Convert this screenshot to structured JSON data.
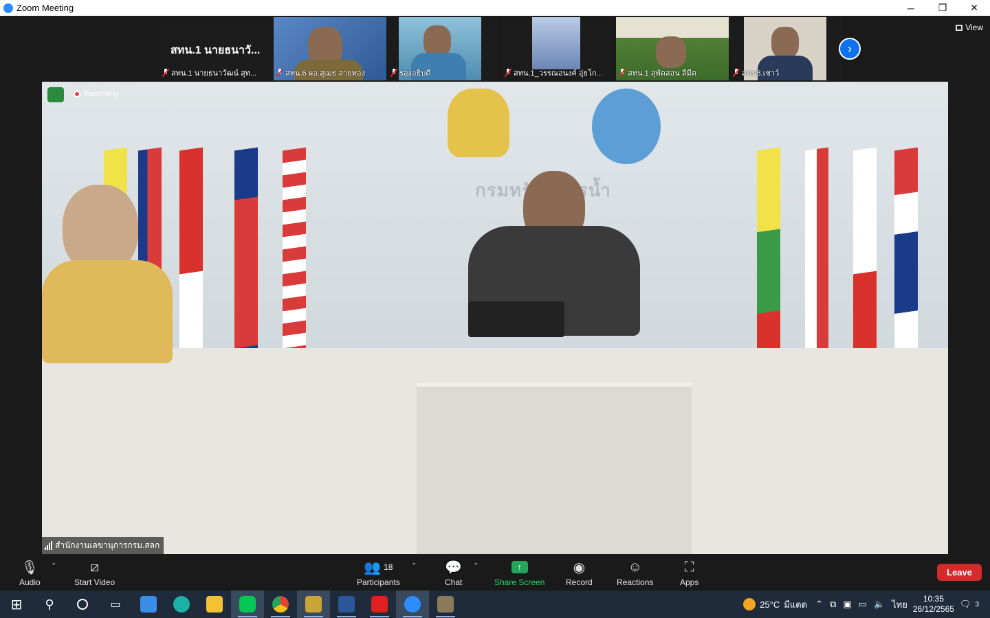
{
  "window": {
    "title": "Zoom Meeting",
    "controls": [
      "─",
      "❐",
      "✕"
    ]
  },
  "gallery": {
    "tiles": [
      {
        "name": "สทน.1 นายธนาวัฒน์ สุท...",
        "big": "สทน.1 นายธนาวั...",
        "muted": true,
        "video": false
      },
      {
        "name": "สทน.6 ผอ.สุเมธ สายทอง",
        "muted": true,
        "video": true,
        "bg": "#3b6fb0"
      },
      {
        "name": "รองอธิบดี",
        "muted": true,
        "video": true,
        "bg": "#6fa8c7"
      },
      {
        "name": "สทน.1_วรรณอนงค์ อุ่ยโก...",
        "muted": true,
        "video": true,
        "bg": "#7a93b8"
      },
      {
        "name": "สทน.1 สุพัตสอน ลีมีต",
        "muted": true,
        "video": true,
        "bg": "#6b8a4a"
      },
      {
        "name": "สทน8.เชาว์",
        "muted": true,
        "video": true,
        "bg": "#c9c4b6"
      }
    ],
    "view_label": "View"
  },
  "main_video": {
    "recording_label": "Recording",
    "participant_label": "สำนักงานเลขานุการกรม.สลก",
    "sign_text": "กรมทรัพยากรน้ำ"
  },
  "toolbar": {
    "audio": "Audio",
    "start_video": "Start Video",
    "participants": "Participants",
    "participants_count": "18",
    "chat": "Chat",
    "share_screen": "Share Screen",
    "record": "Record",
    "reactions": "Reactions",
    "apps": "Apps",
    "leave": "Leave"
  },
  "taskbar": {
    "weather": "25°C",
    "weather_desc": "มีแดด",
    "language": "ไทย",
    "time": "10:35",
    "date": "26/12/2565",
    "notifications": "3",
    "apps": [
      {
        "name": "windows-start-icon",
        "color": "#ffffff"
      },
      {
        "name": "search-icon",
        "color": "#ffffff"
      },
      {
        "name": "cortana-icon",
        "color": "#ffffff"
      },
      {
        "name": "task-view-icon",
        "color": "#ffffff"
      },
      {
        "name": "store-icon",
        "color": "#3a8ee6"
      },
      {
        "name": "edge-icon",
        "color": "#1bb1a6"
      },
      {
        "name": "file-explorer-icon",
        "color": "#f2c230"
      },
      {
        "name": "line-icon",
        "color": "#06c755"
      },
      {
        "name": "chrome-icon",
        "color": "#e34133"
      },
      {
        "name": "media-icon",
        "color": "#c9a437"
      },
      {
        "name": "word-icon",
        "color": "#2b579a"
      },
      {
        "name": "acrobat-icon",
        "color": "#e02020"
      },
      {
        "name": "zoom-icon",
        "color": "#2d8cff"
      },
      {
        "name": "camera-icon",
        "color": "#8a7a5a"
      }
    ]
  }
}
